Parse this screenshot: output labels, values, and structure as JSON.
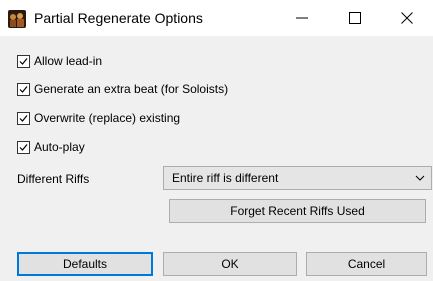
{
  "window": {
    "title": "Partial Regenerate Options"
  },
  "checkboxes": [
    {
      "label": "Allow lead-in",
      "checked": true
    },
    {
      "label": "Generate an extra beat (for Soloists)",
      "checked": true
    },
    {
      "label": "Overwrite (replace) existing",
      "checked": true
    },
    {
      "label": "Auto-play",
      "checked": true
    }
  ],
  "different_riffs": {
    "label": "Different Riffs",
    "value": "Entire riff is different"
  },
  "buttons": {
    "forget": "Forget Recent Riffs Used",
    "defaults": "Defaults",
    "ok": "OK",
    "cancel": "Cancel"
  },
  "icons": {
    "app": "band-app-icon",
    "minimize": "minimize-icon",
    "maximize": "maximize-icon",
    "close": "close-icon",
    "dropdown": "chevron-down-icon"
  }
}
